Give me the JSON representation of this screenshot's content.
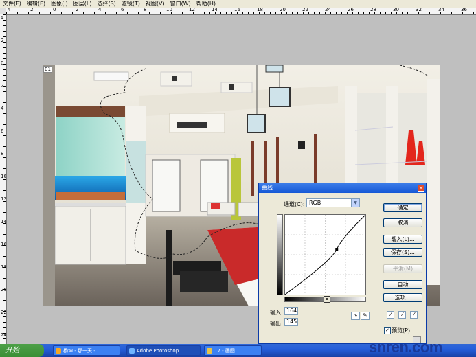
{
  "menu": [
    "文件(F)",
    "编辑(E)",
    "图象(I)",
    "图层(L)",
    "选择(S)",
    "滤镜(T)",
    "视图(V)",
    "窗口(W)",
    "帮助(H)"
  ],
  "ruler_h_numbers": [
    "4",
    "2",
    "0",
    "2",
    "4",
    "6",
    "8",
    "10",
    "12",
    "14",
    "16",
    "18",
    "20",
    "22",
    "24",
    "26",
    "28",
    "30",
    "32",
    "34",
    "36"
  ],
  "ruler_v_numbers": [
    "4",
    "2",
    "0",
    "2",
    "4",
    "6",
    "8",
    "10",
    "12",
    "14",
    "16",
    "18",
    "20",
    "22",
    "24"
  ],
  "document": {
    "zoom_label": "01"
  },
  "curves_dialog": {
    "title": "曲线",
    "close_glyph": "×",
    "channel_label": "通道(C):",
    "channel_value": "RGB",
    "input_label": "输入:",
    "input_value": "164",
    "output_label": "输出:",
    "output_value": "145",
    "buttons": {
      "ok": "确定",
      "cancel": "取消",
      "load": "载入(L)...",
      "save": "保存(S)...",
      "smooth": "平滑(M)",
      "auto": "自动",
      "options": "选项..."
    },
    "preview_label": "预览(P)",
    "preview_checked": true,
    "curve_point": {
      "input": 164,
      "output": 145
    }
  },
  "taskbar": {
    "start_label": "开始",
    "tasks": [
      {
        "label": "杨坤 - 那一天 -",
        "icon": "media-player-icon"
      },
      {
        "label": "Adobe Photoshop",
        "icon": "photoshop-icon"
      },
      {
        "label": "17 - 画图",
        "icon": "paint-icon"
      }
    ]
  },
  "watermark": {
    "text": "snren.com"
  },
  "colors": {
    "taskbar": "#245edb",
    "start": "#3b8f35",
    "title_bar": "#1558d6",
    "workspace": "#bfbfbf"
  }
}
